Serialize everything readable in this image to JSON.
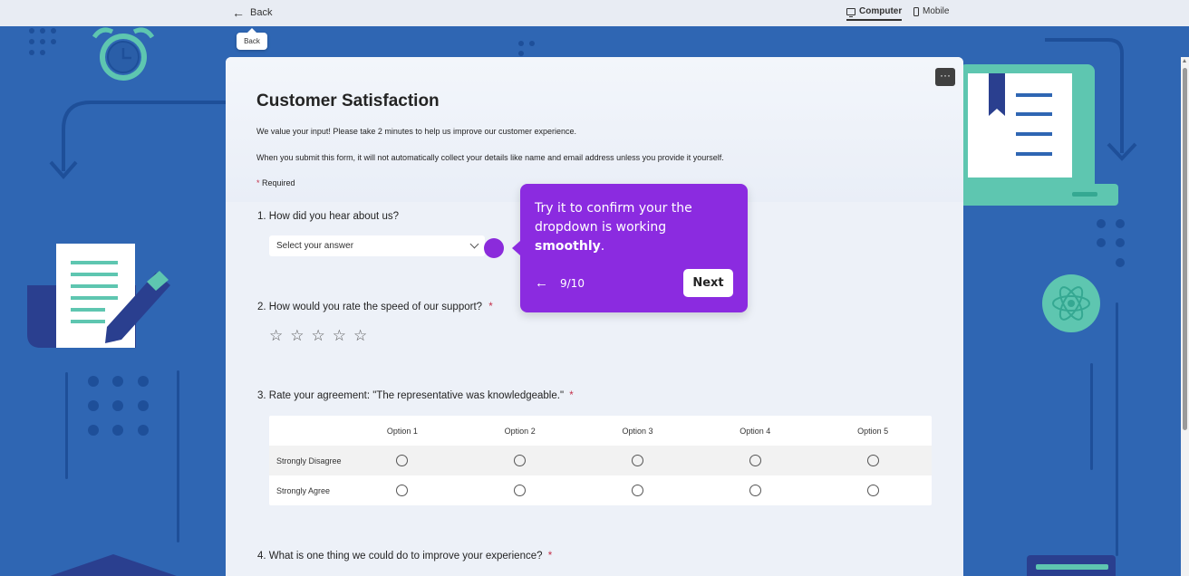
{
  "topbar": {
    "back_label": "Back",
    "back_tooltip": "Back",
    "view_computer_label": "Computer",
    "view_mobile_label": "Mobile"
  },
  "form": {
    "title": "Customer Satisfaction",
    "description": "We value your input! Please take 2 minutes to help us improve our customer experience.",
    "privacy_note": "When you submit this form, it will not automatically collect your details like name and email address unless you provide it yourself.",
    "required_star": "*",
    "required_label": "Required",
    "more_label": "···",
    "questions": [
      {
        "title": "1. How did you hear about us?",
        "placeholder": "Select your answer"
      },
      {
        "title": "2. How would you rate the speed of our support?",
        "required": "*",
        "stars": [
          "☆",
          "☆",
          "☆",
          "☆",
          "☆"
        ]
      },
      {
        "title": "3. Rate your agreement: \"The representative was knowledgeable.\"",
        "required": "*"
      },
      {
        "title": "4. What is one thing we could do to improve your experience?",
        "required": "*"
      }
    ],
    "matrix": {
      "columns": [
        "Option 1",
        "Option 2",
        "Option 3",
        "Option 4",
        "Option 5"
      ],
      "rows": [
        "Strongly Disagree",
        "Strongly Agree"
      ]
    }
  },
  "coachmark": {
    "text_prefix": "Try it to confirm your the dropdown is working ",
    "text_bold": "smoothly",
    "text_suffix": ".",
    "prev_arrow": "←",
    "step": "9/10",
    "next_label": "Next"
  },
  "colors": {
    "background": "#2f66b3",
    "accent_purple": "#8b2be0",
    "required_red": "#c4314b"
  }
}
